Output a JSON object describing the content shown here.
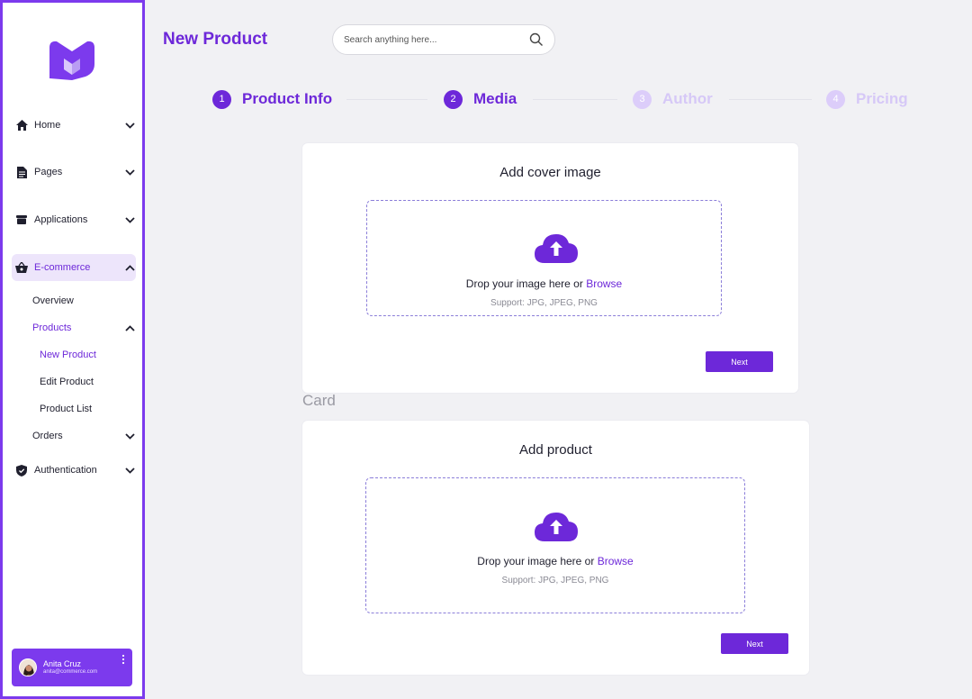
{
  "sidebar": {
    "nav": [
      {
        "label": "Home"
      },
      {
        "label": "Pages"
      },
      {
        "label": "Applications"
      },
      {
        "label": "E-commerce"
      },
      {
        "label": "Authentication"
      }
    ],
    "ecommerce_sub": {
      "overview": "Overview",
      "products": "Products",
      "orders": "Orders"
    },
    "products_sub": {
      "new_product": "New Product",
      "edit_product": "Edit Product",
      "product_list": "Product List"
    },
    "user": {
      "name": "Anita Cruz",
      "email": "anita@commerce.com"
    }
  },
  "header": {
    "title": "New Product",
    "search_placeholder": "Search anything here..."
  },
  "stepper": [
    {
      "number": "1",
      "label": "Product Info",
      "state": "active"
    },
    {
      "number": "2",
      "label": "Media",
      "state": "active"
    },
    {
      "number": "3",
      "label": "Author",
      "state": "inactive"
    },
    {
      "number": "4",
      "label": "Pricing",
      "state": "inactive"
    }
  ],
  "cover_card": {
    "title": "Add cover image",
    "drop_text": "Drop your image here or ",
    "browse": "Browse",
    "support": "Support: JPG, JPEG, PNG",
    "next": "Next"
  },
  "card_label": "Card",
  "product_card": {
    "title": "Add product",
    "drop_text": "Drop your image here or ",
    "browse": "Browse",
    "support": "Support: JPG, JPEG, PNG",
    "next": "Next"
  },
  "colors": {
    "accent": "#6d28d9",
    "accent_light": "#ede5fb",
    "sidebar_border": "#7c3aed",
    "inactive_step": "#d6c8f7"
  }
}
